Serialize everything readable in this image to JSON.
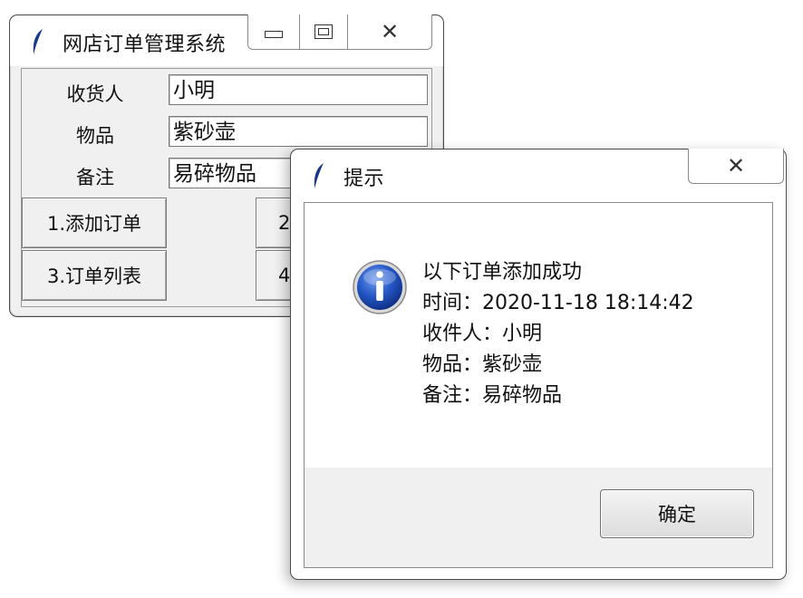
{
  "main_window": {
    "title": "网店订单管理系统",
    "form": {
      "receiver_label": "收货人",
      "receiver_value": "小明",
      "item_label": "物品",
      "item_value": "紫砂壶",
      "note_label": "备注",
      "note_value": "易碎物品"
    },
    "buttons": {
      "add_order": "1.添加订单",
      "btn2_partial": "2",
      "order_list": "3.订单列表",
      "btn4_partial": "4"
    }
  },
  "dialog": {
    "title": "提示",
    "icon": "info-icon",
    "message": {
      "line1": "以下订单添加成功",
      "line2": "时间：2020-11-18 18:14:42",
      "line3": "收件人：小明",
      "line4": "物品：紫砂壶",
      "line5": "备注：易碎物品"
    },
    "ok_label": "确定"
  },
  "colors": {
    "window_bg": "#f0f0f0",
    "border": "#4a4a4a",
    "info_blue": "#1f4fb8"
  }
}
